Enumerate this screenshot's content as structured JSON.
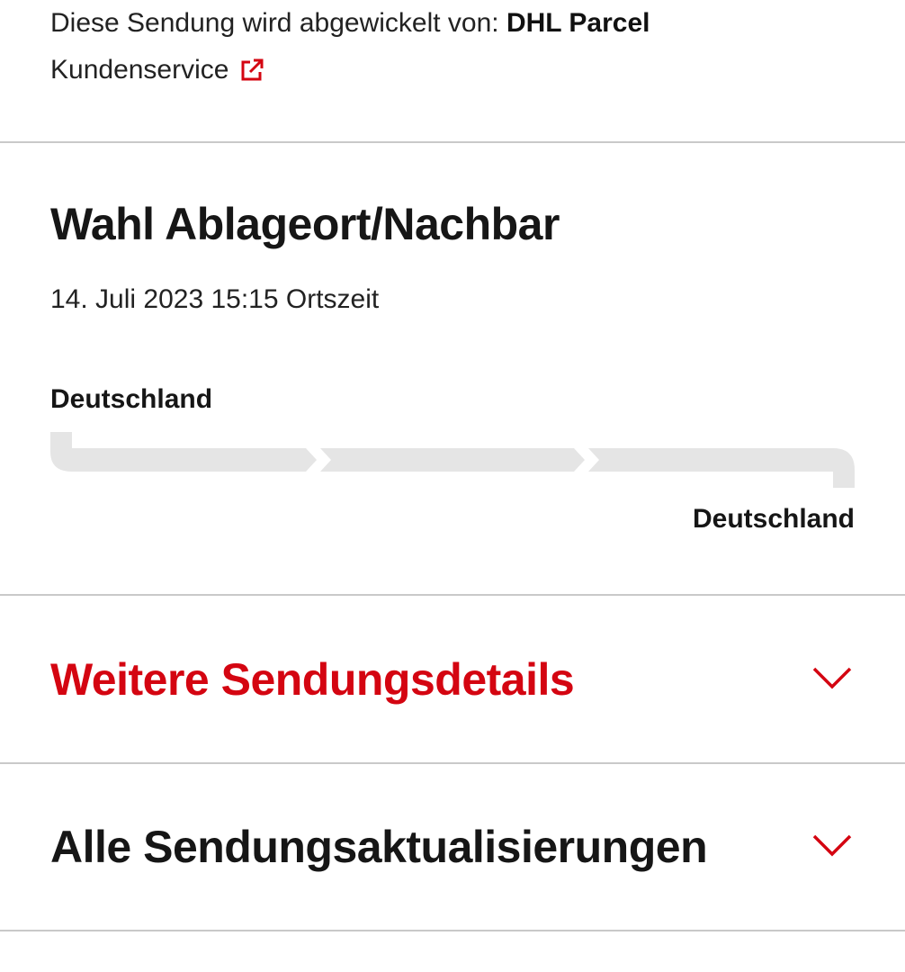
{
  "handler": {
    "prefix": "Diese Sendung wird abgewickelt von: ",
    "carrier": "DHL Parcel",
    "customer_service_label": "Kundenservice"
  },
  "status": {
    "title": "Wahl Ablageort/Nachbar",
    "timestamp": "14. Juli 2023 15:15 Ortszeit"
  },
  "route": {
    "origin": "Deutschland",
    "destination": "Deutschland",
    "segments_total": 3,
    "segments_completed": 0
  },
  "sections": {
    "details": {
      "label": "Weitere Sendungsdetails",
      "expanded": false
    },
    "updates": {
      "label": "Alle Sendungsaktualisierungen",
      "expanded": false
    }
  },
  "icons": {
    "external_link": "external-link-icon",
    "chevron": "chevron-down-icon"
  },
  "colors": {
    "brand_red": "#d40511",
    "track_gray": "#e5e5e5",
    "divider": "#c9c9c9"
  }
}
